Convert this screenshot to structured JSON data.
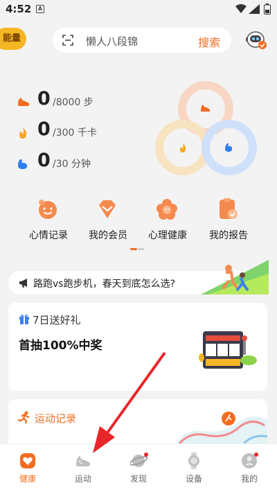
{
  "status_bar": {
    "time": "4:52",
    "notification_icon": "A"
  },
  "header": {
    "energy_label": "能量",
    "search_placeholder": "懒人八段锦",
    "search_button": "搜索"
  },
  "stats": [
    {
      "icon": "shoe-icon",
      "value": "0",
      "goal": "/8000 步"
    },
    {
      "icon": "flame-icon",
      "value": "0",
      "goal": "/300 千卡"
    },
    {
      "icon": "muscle-icon",
      "value": "0",
      "goal": "/30 分钟"
    }
  ],
  "quick_links": [
    {
      "label": "心情记录",
      "icon": "mood-face-icon"
    },
    {
      "label": "我的会员",
      "icon": "vip-diamond-icon"
    },
    {
      "label": "心理健康",
      "icon": "mental-health-flower-icon"
    },
    {
      "label": "我的报告",
      "icon": "report-clipboard-icon"
    }
  ],
  "notice": {
    "text": "路跑vs跑步机，春天到底怎么选?"
  },
  "gift_card": {
    "title": "7日送好礼",
    "subtitle": "首抽100%中奖"
  },
  "run_card": {
    "title": "运动记录"
  },
  "tabs": [
    {
      "label": "健康",
      "icon": "heart-icon",
      "active": true
    },
    {
      "label": "运动",
      "icon": "sneaker-icon",
      "active": false
    },
    {
      "label": "发现",
      "icon": "planet-icon",
      "active": false
    },
    {
      "label": "设备",
      "icon": "watch-icon",
      "active": false
    },
    {
      "label": "我的",
      "icon": "profile-icon",
      "active": false
    }
  ],
  "colors": {
    "accent": "#f26d21",
    "energy": "#f5b625",
    "arrow": "#e8262a"
  }
}
